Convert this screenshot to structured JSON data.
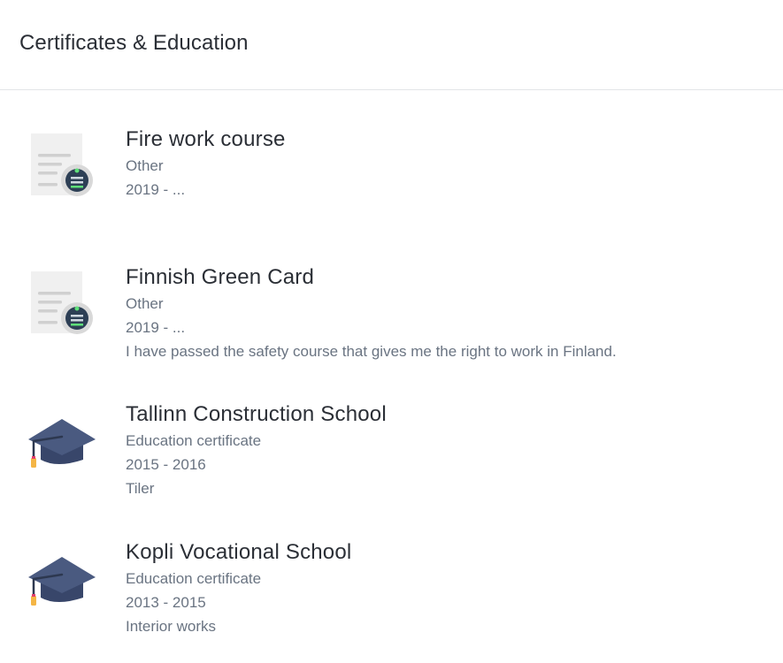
{
  "header": {
    "title": "Certificates & Education"
  },
  "entries": [
    {
      "icon": "certificate-icon",
      "title": "Fire work course",
      "type": "Other",
      "dates": "2019 - ...",
      "description": ""
    },
    {
      "icon": "certificate-icon",
      "title": "Finnish Green Card",
      "type": "Other",
      "dates": "2019 - ...",
      "description": "I have passed the safety course that gives me the right to work in Finland."
    },
    {
      "icon": "graduation-cap-icon",
      "title": "Tallinn Construction School",
      "type": "Education certificate",
      "dates": "2015 - 2016",
      "description": "Tiler"
    },
    {
      "icon": "graduation-cap-icon",
      "title": "Kopli Vocational School",
      "type": "Education certificate",
      "dates": "2013 - 2015",
      "description": "Interior works"
    }
  ],
  "colors": {
    "cap": "#4a5a80",
    "cap_dark": "#38466a",
    "tassel": "#f4b545",
    "badge": "#2d3f55",
    "badge_line": "#5fe07a",
    "paper": "#f0f0f0",
    "paper_line": "#cfcfcf"
  }
}
